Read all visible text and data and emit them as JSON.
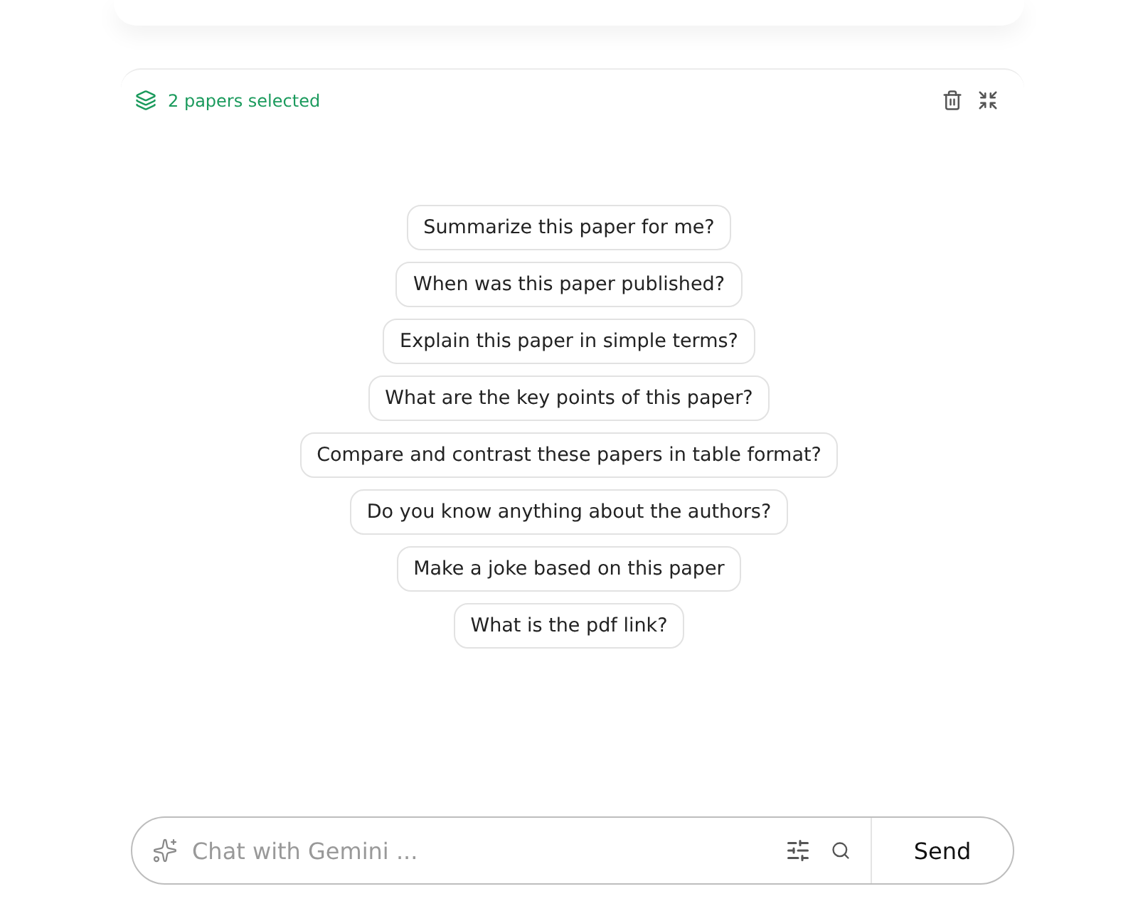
{
  "selection": {
    "label": "2 papers selected"
  },
  "suggestions": [
    "Summarize this paper for me?",
    "When was this paper published?",
    "Explain this paper in simple terms?",
    "What are the key points of this paper?",
    "Compare and contrast these papers in table format?",
    "Do you know anything about the authors?",
    "Make a joke based on this paper",
    "What is the pdf link?"
  ],
  "chat": {
    "placeholder": "Chat with Gemini ...",
    "send": "Send"
  }
}
